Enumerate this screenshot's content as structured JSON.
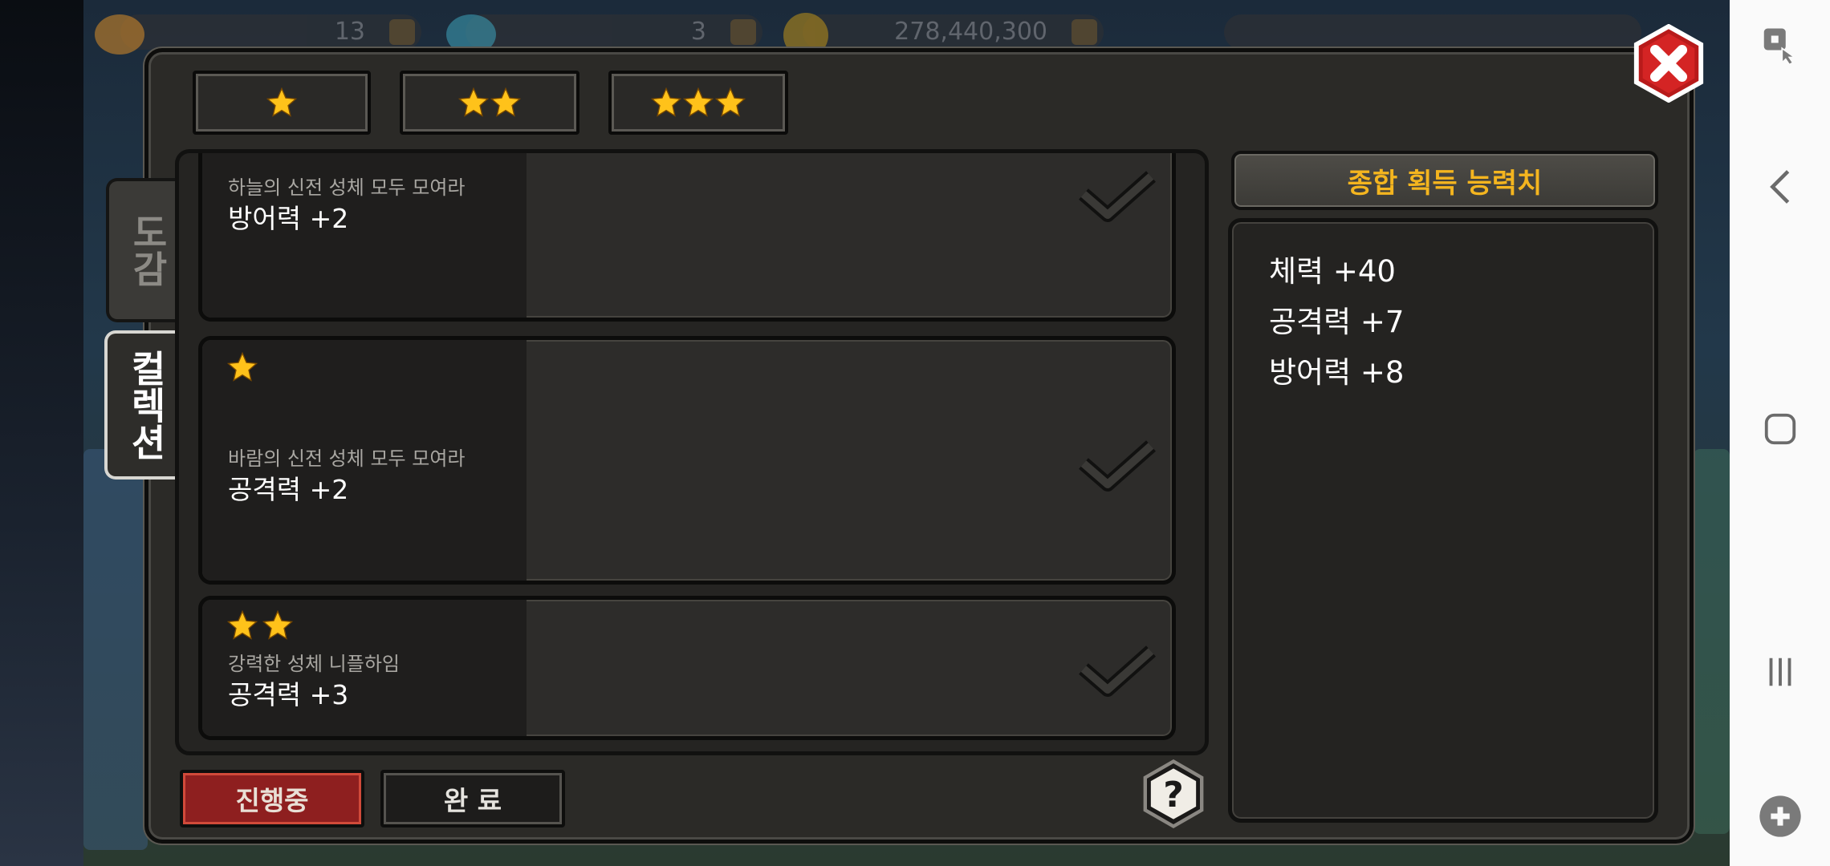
{
  "hud": {
    "gems": "13",
    "crystals": "3",
    "gold": "278,440,300"
  },
  "filters": {
    "one_star": "1-star",
    "two_star": "2-star",
    "three_star": "3-star"
  },
  "side_tabs": {
    "encyclopedia": "도감",
    "collection": "컬렉션"
  },
  "cards": [
    {
      "title": "하늘의 신전 성체 모두 모여라",
      "reward": "방어력 +2",
      "stars": 0
    },
    {
      "title": "바람의 신전 성체 모두 모여라",
      "reward": "공격력 +2",
      "stars": 1
    },
    {
      "title": "강력한 성체 니플하임",
      "reward": "공격력 +3",
      "stars": 2
    }
  ],
  "summary": {
    "header": "종합 획득 능력치",
    "stats": [
      "체력 +40",
      "공격력 +7",
      "방어력 +8"
    ]
  },
  "bottom": {
    "in_progress": "진행중",
    "done": "완 료"
  },
  "colors": {
    "accent_gold": "#f4b51f",
    "star": "#ffc21a",
    "active_red": "#8e1f1f"
  }
}
